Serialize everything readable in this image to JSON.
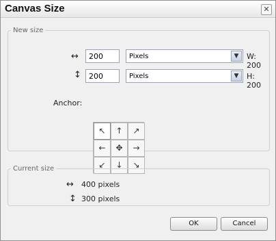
{
  "window": {
    "title": "Canvas Size"
  },
  "new_size": {
    "legend": "New size",
    "width": {
      "value": "200",
      "unit": "Pixels",
      "summary": "W: 200"
    },
    "height": {
      "value": "200",
      "unit": "Pixels",
      "summary": "H: 200"
    },
    "anchor_label": "Anchor:",
    "anchor_icons": [
      "↖",
      "↑",
      "↗",
      "←",
      "✥",
      "→",
      "↙",
      "↓",
      "↘"
    ]
  },
  "current_size": {
    "legend": "Current size",
    "width": "400  pixels",
    "height": "300  pixels"
  },
  "buttons": {
    "ok": "OK",
    "cancel": "Cancel"
  },
  "icons": {
    "close": "✕",
    "width_arrow": "↔",
    "height_arrow": "↕",
    "dropdown": "▼"
  }
}
